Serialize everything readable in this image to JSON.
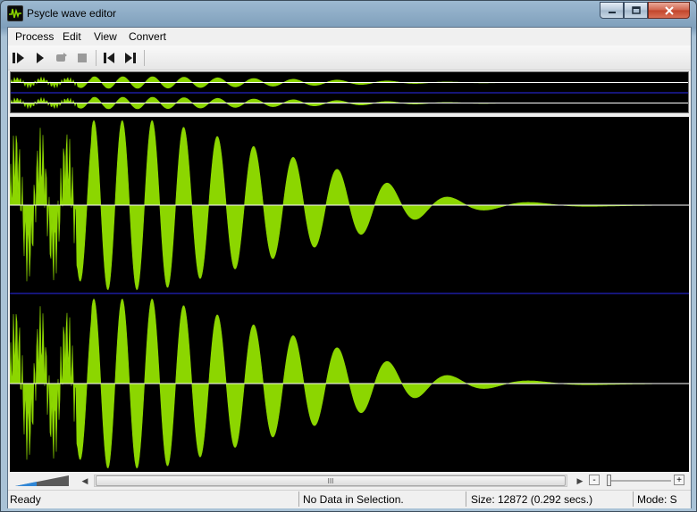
{
  "window": {
    "title": "Psycle wave editor"
  },
  "menu": [
    "Process",
    "Edit",
    "View",
    "Convert"
  ],
  "toolbar": {
    "buttons": [
      {
        "name": "play-from-start-icon"
      },
      {
        "name": "play-icon"
      },
      {
        "name": "loop-icon"
      },
      {
        "name": "stop-icon"
      },
      {
        "name": "go-to-start-icon"
      },
      {
        "name": "go-to-end-icon"
      }
    ]
  },
  "scrollbar": {
    "grip": "III"
  },
  "zoom": {
    "minus": "-",
    "plus": "+"
  },
  "status": {
    "state": "Ready",
    "selection": "No Data in Selection.",
    "size": "Size: 12872 (0.292 secs.)",
    "mode": "Mode: S"
  },
  "colors": {
    "wave": "#8cd600",
    "background": "#000000",
    "channel_divider": "#1c1ca0",
    "zero_line": "#ffffff"
  }
}
